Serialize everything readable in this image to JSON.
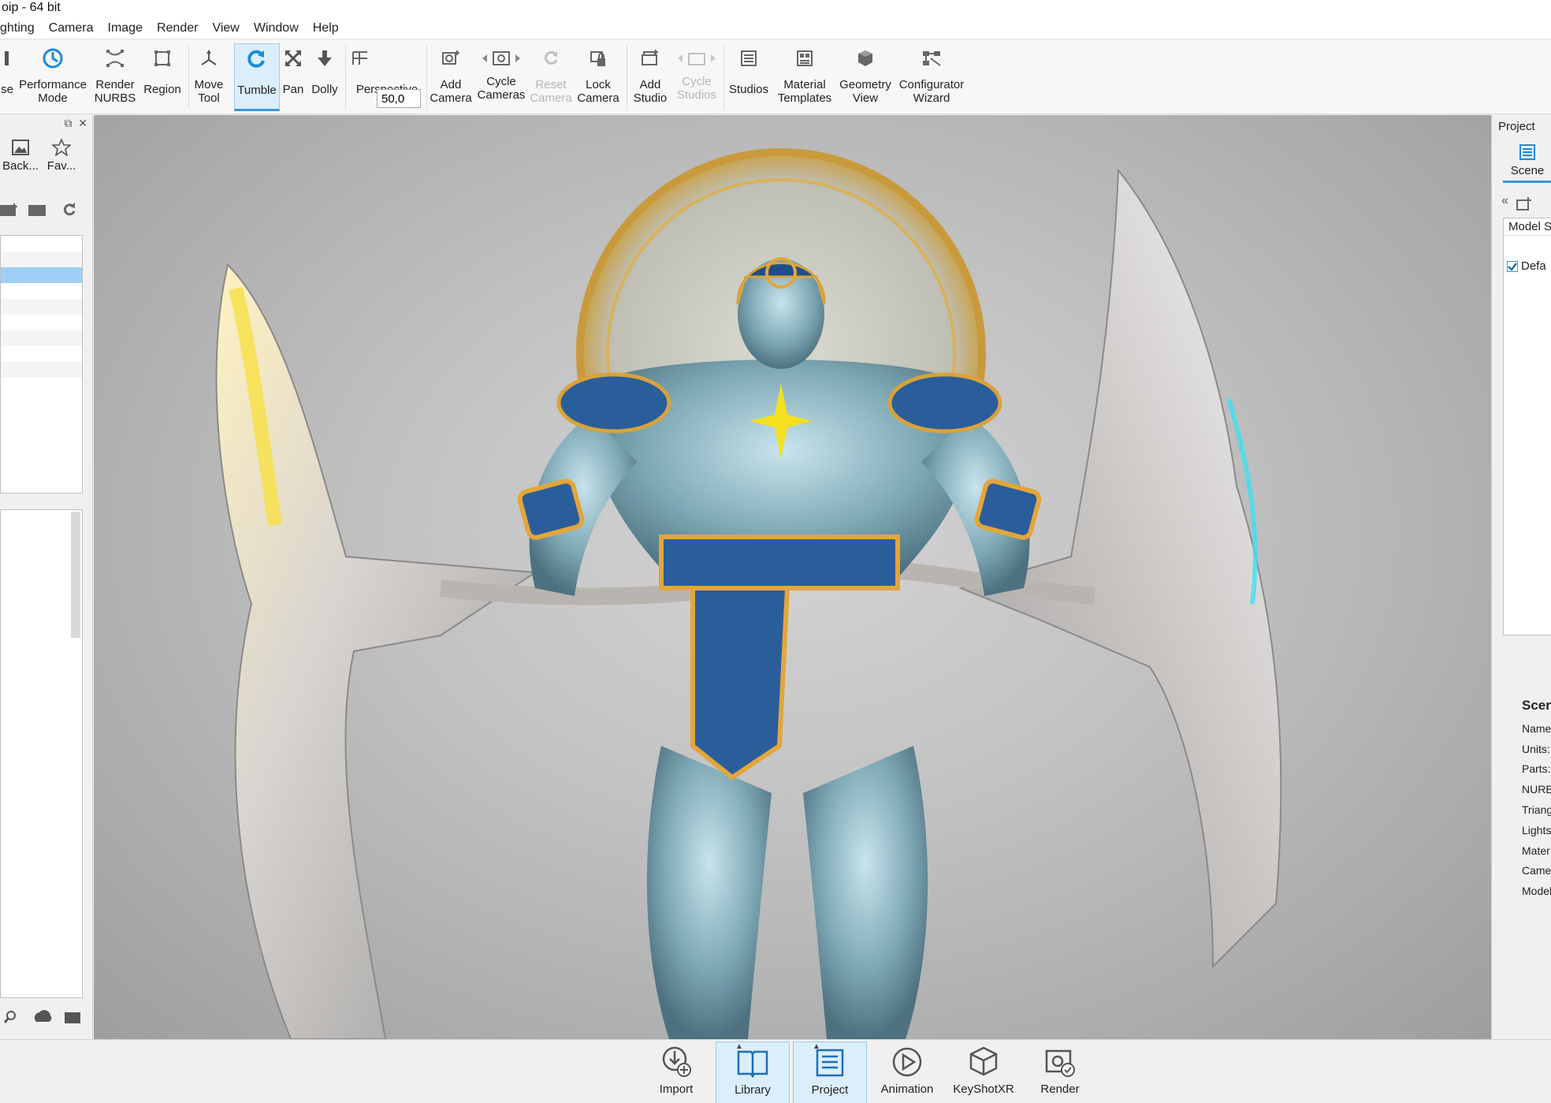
{
  "window": {
    "title": "oip  - 64 bit"
  },
  "menu": [
    "ghting",
    "Camera",
    "Image",
    "Render",
    "View",
    "Window",
    "Help"
  ],
  "ribbon": {
    "partial_left": "se",
    "performance_mode": "Performance\nMode",
    "render_nurbs": "Render\nNURBS",
    "region": "Region",
    "move_tool": "Move\nTool",
    "tumble": "Tumble",
    "pan": "Pan",
    "dolly": "Dolly",
    "fov_value": "50,0",
    "perspective": "Perspective",
    "add_camera": "Add\nCamera",
    "cycle_cameras": "Cycle\nCameras",
    "reset_camera": "Reset\nCamera",
    "lock_camera": "Lock\nCamera",
    "add_studio": "Add\nStudio",
    "cycle_studios": "Cycle\nStudios",
    "studios": "Studios",
    "material_templates": "Material\nTemplates",
    "geometry_view": "Geometry\nView",
    "configurator_wizard": "Configurator\nWizard"
  },
  "left_panel": {
    "tab_back": "Back...",
    "tab_fav": "Fav..."
  },
  "right_panel": {
    "title": "Project",
    "scene_tab": "Scene",
    "tree_header": "Model S",
    "tree_item": "Defa",
    "info_heading": "Scen",
    "info_labels": [
      "Name",
      "Units:",
      "Parts:",
      "NURB",
      "Triang",
      "Lights",
      "Mater",
      "Came",
      "Model"
    ]
  },
  "dock": [
    "Import",
    "Library",
    "Project",
    "Animation",
    "KeyShotXR",
    "Render"
  ],
  "colors": {
    "accent": "#3a96dd",
    "active_bg": "#dbeefc",
    "viewport_bg": "#c2c2c2"
  }
}
